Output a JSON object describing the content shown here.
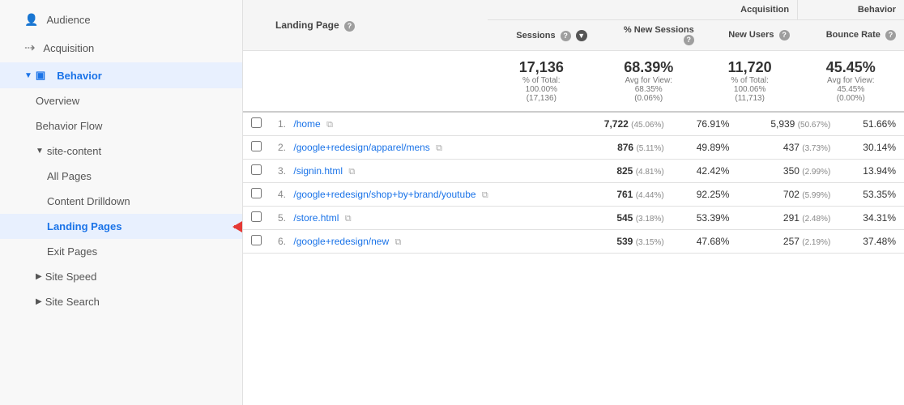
{
  "sidebar": {
    "items": [
      {
        "id": "audience",
        "label": "Audience",
        "icon": "👤",
        "indent": "indent1",
        "active": false
      },
      {
        "id": "acquisition",
        "label": "Acquisition",
        "icon": "→",
        "indent": "indent1",
        "active": false
      },
      {
        "id": "behavior",
        "label": "Behavior",
        "icon": "▣",
        "indent": "indent1",
        "active": true,
        "arrow": "▼"
      },
      {
        "id": "overview",
        "label": "Overview",
        "icon": "",
        "indent": "indent2",
        "active": false
      },
      {
        "id": "behavior-flow",
        "label": "Behavior Flow",
        "icon": "",
        "indent": "indent2",
        "active": false
      },
      {
        "id": "site-content",
        "label": "▶  Site Content",
        "icon": "",
        "indent": "indent2",
        "active": false
      },
      {
        "id": "all-pages",
        "label": "All Pages",
        "icon": "",
        "indent": "indent3",
        "active": false
      },
      {
        "id": "content-drilldown",
        "label": "Content Drilldown",
        "icon": "",
        "indent": "indent3",
        "active": false
      },
      {
        "id": "landing-pages",
        "label": "Landing Pages",
        "icon": "",
        "indent": "indent3",
        "active": true
      },
      {
        "id": "exit-pages",
        "label": "Exit Pages",
        "icon": "",
        "indent": "indent3",
        "active": false
      },
      {
        "id": "site-speed",
        "label": "▶  Site Speed",
        "icon": "",
        "indent": "indent2",
        "active": false
      },
      {
        "id": "site-search",
        "label": "▶  Site Search",
        "icon": "",
        "indent": "indent2",
        "active": false
      }
    ]
  },
  "table": {
    "group_acquisition": "Acquisition",
    "group_behavior": "Behavior",
    "col_landing_page": "Landing Page",
    "col_sessions": "Sessions",
    "col_new_sessions": "% New Sessions",
    "col_new_users": "New Users",
    "col_bounce_rate": "Bounce Rate",
    "summary": {
      "sessions_big": "17,136",
      "sessions_sub1": "% of Total:",
      "sessions_sub2": "100.00%",
      "sessions_sub3": "(17,136)",
      "new_sessions_big": "68.39%",
      "new_sessions_sub1": "Avg for View:",
      "new_sessions_sub2": "68.35%",
      "new_sessions_sub3": "(0.06%)",
      "new_users_big": "11,720",
      "new_users_sub1": "% of Total:",
      "new_users_sub2": "100.06%",
      "new_users_sub3": "(11,713)",
      "bounce_rate_big": "45.45%",
      "bounce_rate_sub1": "Avg for View:",
      "bounce_rate_sub2": "45.45%",
      "bounce_rate_sub3": "(0.00%)"
    },
    "rows": [
      {
        "num": "1.",
        "page": "/home",
        "sessions": "7,722",
        "sessions_pct": "(45.06%)",
        "new_sessions": "76.91%",
        "new_users": "5,939",
        "new_users_pct": "(50.67%)",
        "bounce_rate": "51.66%"
      },
      {
        "num": "2.",
        "page": "/google+redesign/apparel/mens",
        "sessions": "876",
        "sessions_pct": "(5.11%)",
        "new_sessions": "49.89%",
        "new_users": "437",
        "new_users_pct": "(3.73%)",
        "bounce_rate": "30.14%"
      },
      {
        "num": "3.",
        "page": "/signin.html",
        "sessions": "825",
        "sessions_pct": "(4.81%)",
        "new_sessions": "42.42%",
        "new_users": "350",
        "new_users_pct": "(2.99%)",
        "bounce_rate": "13.94%"
      },
      {
        "num": "4.",
        "page": "/google+redesign/shop+by+brand/youtube",
        "sessions": "761",
        "sessions_pct": "(4.44%)",
        "new_sessions": "92.25%",
        "new_users": "702",
        "new_users_pct": "(5.99%)",
        "bounce_rate": "53.35%"
      },
      {
        "num": "5.",
        "page": "/store.html",
        "sessions": "545",
        "sessions_pct": "(3.18%)",
        "new_sessions": "53.39%",
        "new_users": "291",
        "new_users_pct": "(2.48%)",
        "bounce_rate": "34.31%"
      },
      {
        "num": "6.",
        "page": "/google+redesign/new",
        "sessions": "539",
        "sessions_pct": "(3.15%)",
        "new_sessions": "47.68%",
        "new_users": "257",
        "new_users_pct": "(2.19%)",
        "bounce_rate": "37.48%"
      }
    ]
  },
  "arrow_annotation": {
    "visible": true
  }
}
